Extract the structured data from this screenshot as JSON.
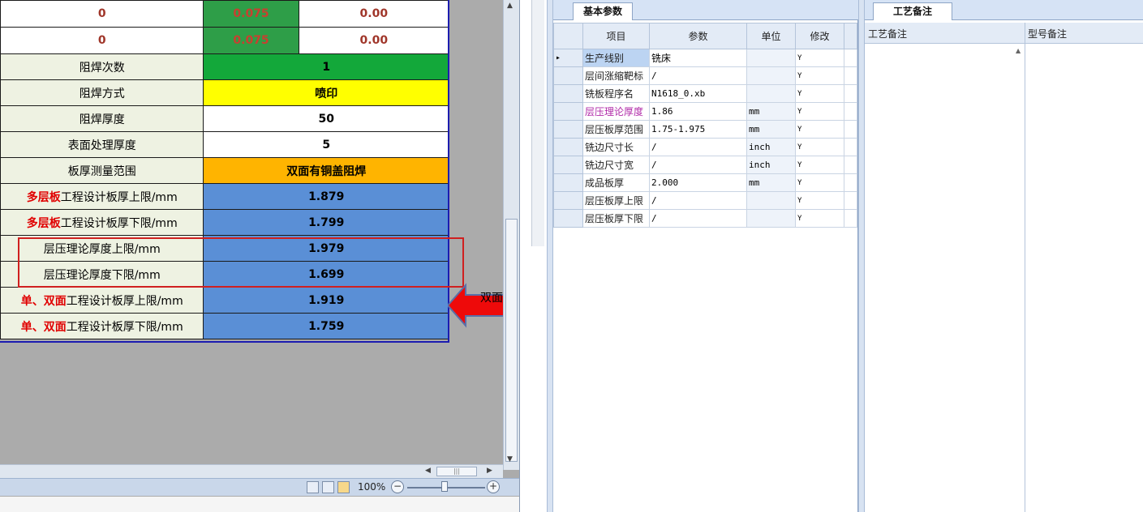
{
  "sheet": {
    "top_rows": [
      {
        "a": "0",
        "b": "0.075",
        "c": "0.00"
      },
      {
        "a": "0",
        "b": "0.075",
        "c": "0.00"
      }
    ],
    "rows": [
      {
        "label": "阻焊次数",
        "value": "1",
        "style": "green"
      },
      {
        "label": "阻焊方式",
        "value": "喷印",
        "style": "yellow"
      },
      {
        "label": "阻焊厚度",
        "value": "50",
        "style": "white"
      },
      {
        "label": "表面处理厚度",
        "value": "5",
        "style": "white"
      },
      {
        "label": "板厚测量范围",
        "value": "双面有铜盖阻焊",
        "style": "orange"
      },
      {
        "label_red": "多层板",
        "label": "工程设计板厚上限/mm",
        "value": "1.879",
        "style": "blue"
      },
      {
        "label_red": "多层板",
        "label": "工程设计板厚下限/mm",
        "value": "1.799",
        "style": "blue"
      },
      {
        "label": "层压理论厚度上限/mm",
        "value": "1.979",
        "style": "blue"
      },
      {
        "label": "层压理论厚度下限/mm",
        "value": "1.699",
        "style": "blue"
      },
      {
        "label_red": "单、双面",
        "label": "工程设计板厚上限/mm",
        "value": "1.919",
        "style": "blue"
      },
      {
        "label_red": "单、双面",
        "label": "工程设计板厚下限/mm",
        "value": "1.759",
        "style": "blue"
      }
    ],
    "arrow_text": "双面",
    "zoom": "100%"
  },
  "params": {
    "tab_label": "基本参数",
    "headers": {
      "item": "项目",
      "param": "参数",
      "unit": "单位",
      "edit": "修改"
    },
    "rows": [
      {
        "item": "生产线别",
        "param": "铣床",
        "unit": "",
        "edit": "Y"
      },
      {
        "item": "层间涨缩靶标",
        "param": "/",
        "unit": "",
        "edit": "Y"
      },
      {
        "item": "铣板程序名",
        "param": "N1618_0.xb",
        "unit": "",
        "edit": "Y"
      },
      {
        "item": "层压理论厚度",
        "param": "1.86",
        "unit": "mm",
        "edit": "Y"
      },
      {
        "item": "层压板厚范围",
        "param": "1.75-1.975",
        "unit": "mm",
        "edit": "Y"
      },
      {
        "item": "铣边尺寸长",
        "param": "/",
        "unit": "inch",
        "edit": "Y"
      },
      {
        "item": "铣边尺寸宽",
        "param": "/",
        "unit": "inch",
        "edit": "Y"
      },
      {
        "item": "成品板厚",
        "param": "2.000",
        "unit": "mm",
        "edit": "Y"
      },
      {
        "item": "层压板厚上限",
        "param": "/",
        "unit": "",
        "edit": "Y"
      },
      {
        "item": "层压板厚下限",
        "param": "/",
        "unit": "",
        "edit": "Y"
      }
    ]
  },
  "notes": {
    "tab_label": "工艺备注",
    "col1": "工艺备注",
    "col2": "型号备注"
  },
  "colors": {
    "green": "#13a83a",
    "yellow": "#ffff00",
    "orange": "#ffb400",
    "blue": "#5a8fd6",
    "red_label": "#e00000",
    "purple_label": "#b02aa8"
  }
}
